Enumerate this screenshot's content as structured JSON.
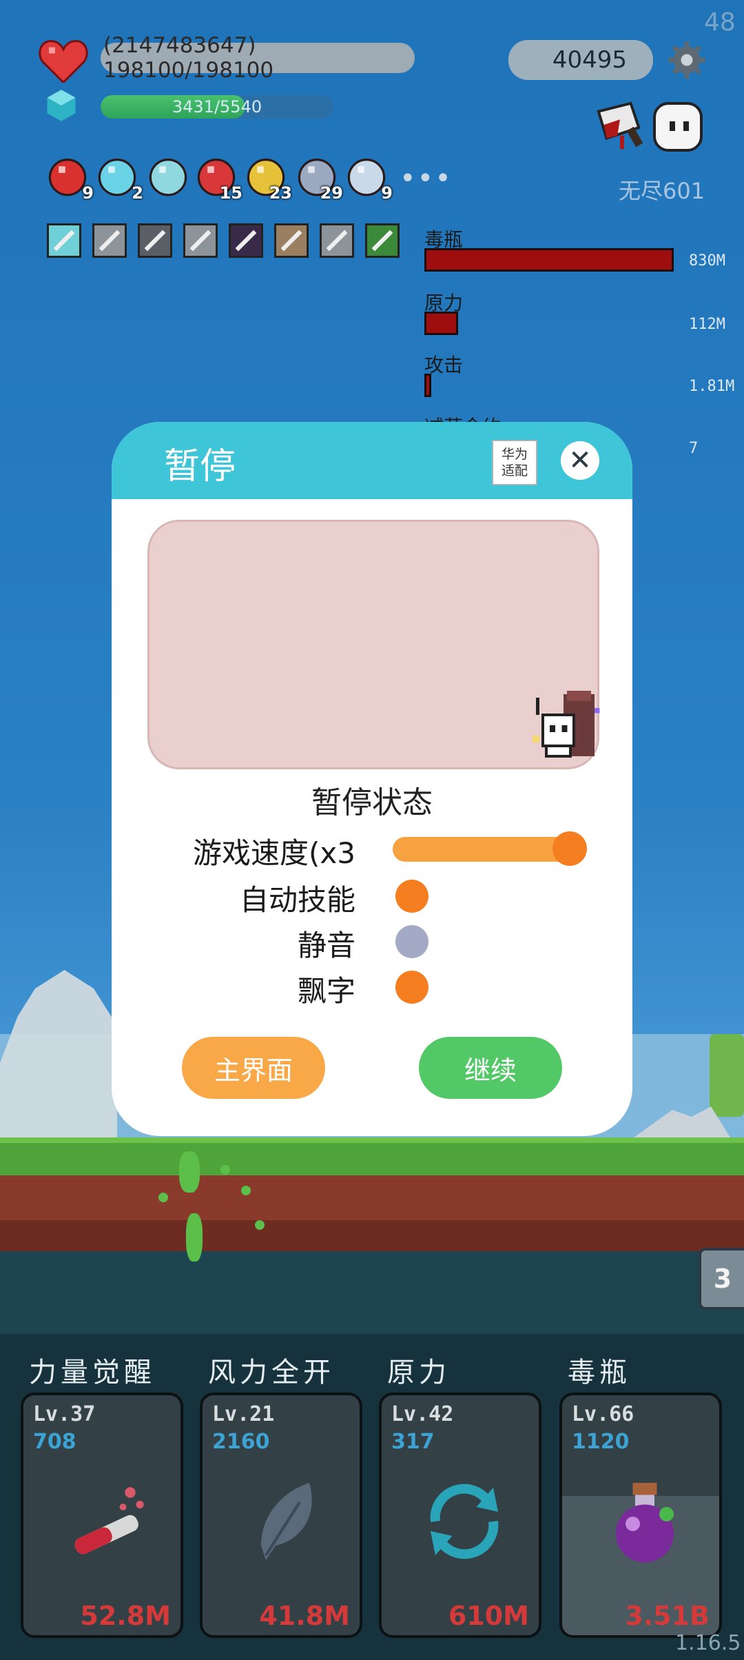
{
  "hud": {
    "fps": "48",
    "hp_text": "(2147483647) 198100/198100",
    "coins": "40495",
    "xp_text": "3431/5540",
    "xp_fraction": 0.62,
    "mode_label": "无尽601"
  },
  "items": [
    {
      "icon": "apple-icon",
      "count": "9"
    },
    {
      "icon": "diamond-icon",
      "count": "2"
    },
    {
      "icon": "magnifier-icon",
      "count": ""
    },
    {
      "icon": "mushroom-icon",
      "count": "15"
    },
    {
      "icon": "crown-icon",
      "count": "23"
    },
    {
      "icon": "star-card-icon",
      "count": "29"
    },
    {
      "icon": "halo-icon",
      "count": "9"
    }
  ],
  "more_dots": "•••",
  "buffs": [
    "lightbulb-buff-icon",
    "sword-buff-icon",
    "dark-sword-buff-icon",
    "sword-buff-icon",
    "shadow-buff-icon",
    "shield-buff-icon",
    "sword-buff-icon",
    "green-rune-buff-icon"
  ],
  "damage_stats": [
    {
      "label": "毒瓶",
      "value": "830M",
      "fraction": 1.0
    },
    {
      "label": "原力",
      "value": "112M",
      "fraction": 0.135
    },
    {
      "label": "攻击",
      "value": "1.81M",
      "fraction": 0.01
    },
    {
      "label": "减蒜金约",
      "value": "7",
      "fraction": 0.0
    }
  ],
  "dialog": {
    "title": "暂停",
    "adapt_label_1": "华为",
    "adapt_label_2": "适配",
    "close_glyph": "✕",
    "state_label": "暂停状态",
    "options": [
      {
        "label": "游戏速度(x3",
        "type": "slider",
        "value": 1.0
      },
      {
        "label": "自动技能",
        "type": "toggle",
        "on": true
      },
      {
        "label": "静音",
        "type": "toggle",
        "on": false
      },
      {
        "label": "飘字",
        "type": "toggle",
        "on": true
      }
    ],
    "main_button": "主界面",
    "continue_button": "继续"
  },
  "skills": [
    {
      "title": "力量觉醒",
      "level": "Lv.37",
      "cost": "708",
      "damage": "52.8M",
      "icon": "potion-tube-icon"
    },
    {
      "title": "风力全开",
      "level": "Lv.21",
      "cost": "2160",
      "damage": "41.8M",
      "icon": "feather-icon"
    },
    {
      "title": "原力",
      "level": "Lv.42",
      "cost": "317",
      "damage": "610M",
      "icon": "cycle-arrows-icon"
    },
    {
      "title": "毒瓶",
      "level": "Lv.66",
      "cost": "1120",
      "damage": "3.51B",
      "icon": "poison-bottle-icon"
    }
  ],
  "stage_tag": "3",
  "version": "1.16.5",
  "colors": {
    "accent_header": "#3ec6d8",
    "slider": "#f57e20",
    "toggle_on": "#f57e20",
    "toggle_off": "#a2aac6",
    "main_button": "#f9a847",
    "continue_button": "#52c867",
    "damage_bar": "#9e0e0e"
  }
}
